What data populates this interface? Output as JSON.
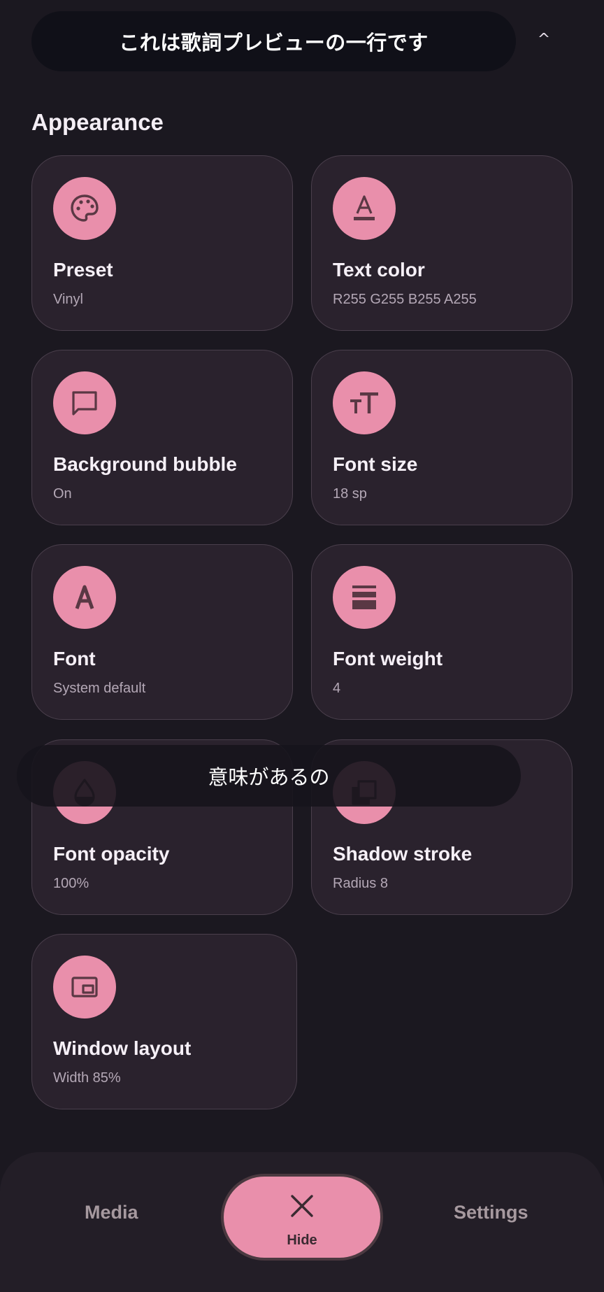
{
  "preview": {
    "lyric_line": "これは歌詞プレビューの一行です",
    "collapse_glyph": "^"
  },
  "section": {
    "title": "Appearance"
  },
  "cards": [
    {
      "title": "Preset",
      "value": "Vinyl",
      "icon": "palette-icon"
    },
    {
      "title": "Text color",
      "value": "R255 G255 B255 A255",
      "icon": "text-color-icon"
    },
    {
      "title": "Background bubble",
      "value": "On",
      "icon": "speech-bubble-icon"
    },
    {
      "title": "Font size",
      "value": "18 sp",
      "icon": "text-size-icon"
    },
    {
      "title": "Font",
      "value": "System default",
      "icon": "font-letter-icon"
    },
    {
      "title": "Font weight",
      "value": "4",
      "icon": "weight-bars-icon"
    },
    {
      "title": "Font opacity",
      "value": "100%",
      "icon": "opacity-drop-icon"
    },
    {
      "title": "Shadow stroke",
      "value": "Radius 8",
      "icon": "shadow-layers-icon"
    },
    {
      "title": "Window layout",
      "value": "Width 85%",
      "icon": "picture-in-picture-icon"
    }
  ],
  "toast": {
    "text": "意味があるの"
  },
  "bottom_nav": {
    "media_label": "Media",
    "hide_label": "Hide",
    "settings_label": "Settings"
  },
  "colors": {
    "background": "#1b1820",
    "card": "#2a222d",
    "accent": "#e98fab",
    "icon_glyph": "#5a3844"
  }
}
